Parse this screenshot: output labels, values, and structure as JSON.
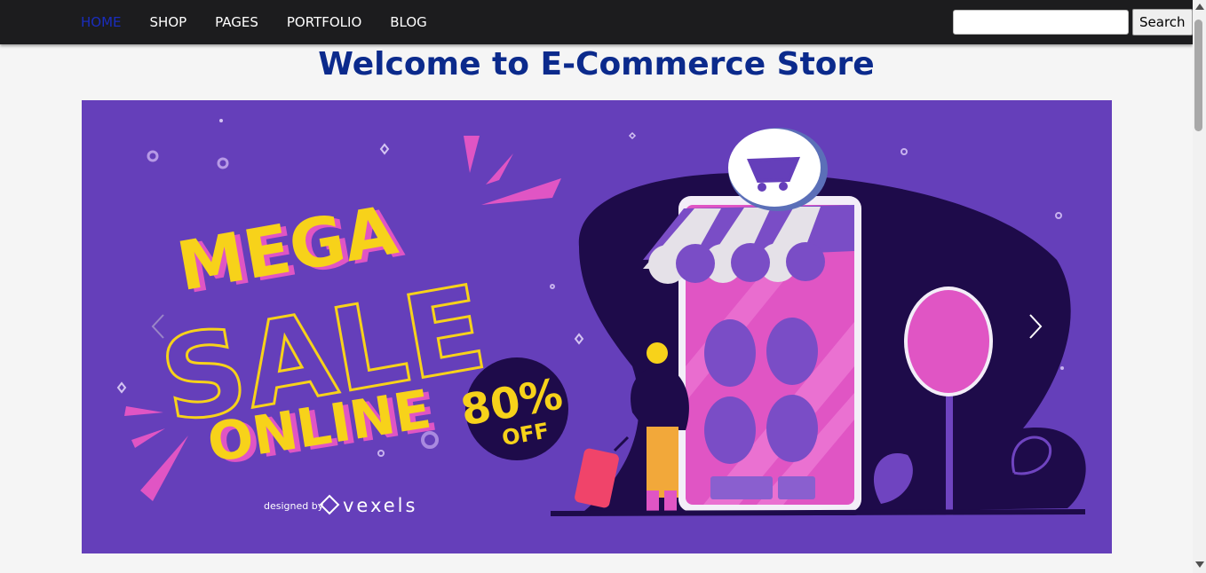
{
  "nav": {
    "items": [
      {
        "label": "HOME",
        "active": true
      },
      {
        "label": "SHOP"
      },
      {
        "label": "PAGES"
      },
      {
        "label": "PORTFOLIO"
      },
      {
        "label": "BLOG"
      }
    ],
    "search_placeholder": "",
    "search_button": "Search"
  },
  "page": {
    "title": "Welcome to E-Commerce Store"
  },
  "banner": {
    "line1": "MEGA",
    "line2": "SALE",
    "line3": "ONLINE",
    "discount": "80%",
    "discount_sub": "OFF",
    "credit_prefix": "designed by",
    "credit_brand": "vexels"
  },
  "colors": {
    "nav_bg": "#1c1c1e",
    "active_link": "#1a2dbd",
    "title": "#0b2a8c",
    "banner_bg": "#653fba",
    "banner_dark": "#1e0b4a",
    "yellow": "#f7d21a",
    "pink": "#e055c4"
  },
  "icons": [
    "chevron-left-icon",
    "chevron-right-icon",
    "shopping-cart-icon"
  ]
}
